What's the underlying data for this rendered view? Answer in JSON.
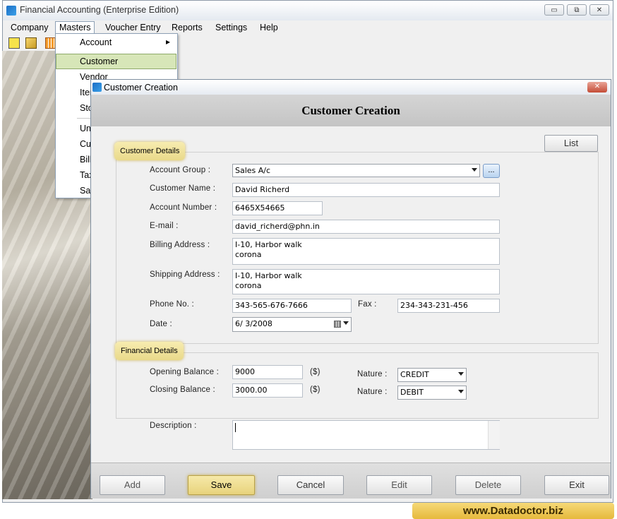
{
  "app": {
    "title": "Financial Accounting (Enterprise Edition)",
    "window_buttons": {
      "minimize": "▭",
      "restore": "⧉",
      "close": "✕"
    }
  },
  "menubar": [
    "Company",
    "Masters",
    "Voucher Entry",
    "Reports",
    "Settings",
    "Help"
  ],
  "masters_menu": {
    "items": [
      "Account",
      "Customer",
      "Vendor",
      "Iter",
      "Sto",
      "Un",
      "Cur",
      "Bill",
      "Tax",
      "Sal"
    ],
    "selected": "Customer",
    "submenu_arrow": "▸"
  },
  "toolbar": {
    "icons": [
      "new-document-icon",
      "open-folder-icon",
      "calendar-icon"
    ]
  },
  "dialog": {
    "title": "Customer Creation",
    "header": "Customer Creation",
    "close_glyph": "✕",
    "list_button": "List",
    "customer_details": {
      "legend": "Customer Details",
      "account_group": {
        "label": "Account Group :",
        "value": "Sales A/c",
        "browse": "..."
      },
      "customer_name": {
        "label": "Customer Name :",
        "value": "David Richerd"
      },
      "account_number": {
        "label": "Account Number :",
        "value": "6465X54665"
      },
      "email": {
        "label": "E-mail :",
        "value": "david_richerd@phn.in"
      },
      "billing_address": {
        "label": "Billing Address :",
        "value": "I-10, Harbor walk\ncorona"
      },
      "shipping_address": {
        "label": "Shipping Address :",
        "value": "I-10, Harbor walk\ncorona"
      },
      "phone": {
        "label": "Phone No. :",
        "value": "343-565-676-7666"
      },
      "fax": {
        "label": "Fax :",
        "value": "234-343-231-456"
      },
      "date": {
        "label": "Date :",
        "value": "6/  3/2008"
      }
    },
    "financial_details": {
      "legend": "Financial Details",
      "opening_balance": {
        "label": "Opening Balance :",
        "value": "9000",
        "unit": "($)"
      },
      "closing_balance": {
        "label": "Closing Balance :",
        "value": "3000.00",
        "unit": "($)"
      },
      "nature_opening": {
        "label": "Nature :",
        "value": "CREDIT"
      },
      "nature_closing": {
        "label": "Nature :",
        "value": "DEBIT"
      }
    },
    "description": {
      "label": "Description :",
      "value": ""
    },
    "buttons": {
      "add": "Add",
      "save": "Save",
      "cancel": "Cancel",
      "edit": "Edit",
      "delete": "Delete",
      "exit": "Exit"
    }
  },
  "banner": "www.Datadoctor.biz",
  "colors": {
    "highlight": "#e9d98a",
    "selection": "#d7e6b8"
  }
}
